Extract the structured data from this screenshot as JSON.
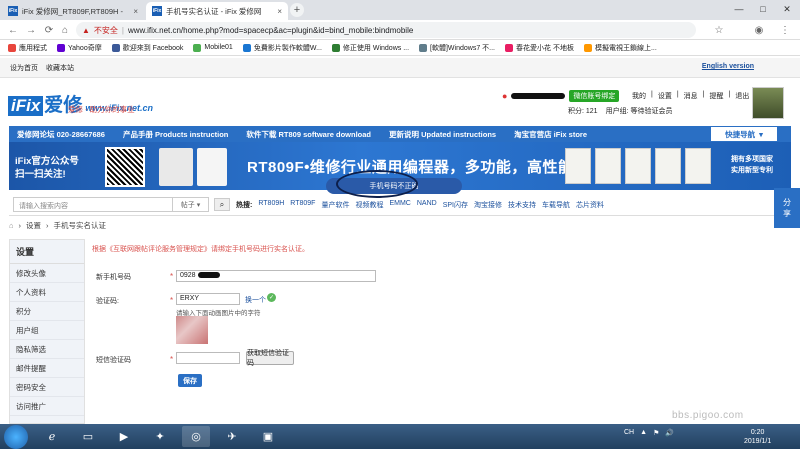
{
  "browser": {
    "tabs": [
      {
        "title": "iFix 爱修网_RT809F,RT809H -",
        "active": false
      },
      {
        "title": "手机号实名认证 - iFix 爱修网",
        "active": true
      }
    ],
    "new_tab_glyph": "+",
    "omnibox": {
      "security_label": "不安全",
      "url": "www.ifix.net.cn/home.php?mod=spacecp&ac=plugin&id=bind_mobile:bindmobile"
    },
    "bookmarks": [
      "應用程式",
      "Yahoo奇摩",
      "歡迎來到 Facebook",
      "Mobile01",
      "免費影片製作軟體W...",
      "修正使用 Windows ...",
      "[軟體]Windows7 不...",
      "春花愛小花 不地板",
      "模擬電視王鎖線上..."
    ],
    "window_controls": [
      "—",
      "□",
      "✕"
    ]
  },
  "site": {
    "topbar": {
      "left_links": [
        "设为首页",
        "收藏本站"
      ],
      "right_link": "English version"
    },
    "logo": {
      "mark": "iFix",
      "name": "爱修",
      "domain": "www.iFix.net.cn",
      "slogan": "爱修 - 助力你的事业"
    },
    "user": {
      "wechat_button": "微信账号绑定",
      "links": [
        "我的",
        "设置",
        "消息",
        "提醒",
        "退出"
      ],
      "points": "积分: 121",
      "group": "用户组: 等待验证会员"
    },
    "nav": {
      "items": [
        "爱修网论坛 020-28667686",
        "产品手册 Products instruction",
        "软件下载 RT809 software download",
        "更新说明 Updated instructions",
        "淘宝官营店 iFix store"
      ],
      "quick_nav": "快捷导航"
    },
    "banner": {
      "wechat_line1": "iFix官方公众号",
      "wechat_line2": "扫一扫关注!",
      "headline": "RT809F•维修行业通用编程器，多功能，高性能",
      "right_line1": "拥有多项国家",
      "right_line2": "实用新型专利"
    },
    "toast": "手机号码不正确",
    "search": {
      "placeholder": "请输入搜索内容",
      "type": "帖子",
      "hot_label": "热搜:",
      "hot_items": [
        "RT809H",
        "RT809F",
        "量产软件",
        "视频教程",
        "EMMC",
        "NAND",
        "SPI闪存",
        "淘宝接修",
        "技术支持",
        "车载导航",
        "芯片资料"
      ]
    },
    "breadcrumb": [
      "设置",
      "手机号实名认证"
    ],
    "share": [
      "分",
      "享"
    ]
  },
  "sidebar": {
    "title": "设置",
    "items": [
      "修改头像",
      "个人资料",
      "积分",
      "用户组",
      "隐私筛选",
      "邮件提醒",
      "密码安全",
      "访问推广"
    ]
  },
  "form": {
    "notice": "根据《互联网跟帖评论服务管理规定》请绑定手机号码进行实名认证。",
    "phone_label": "新手机号码",
    "phone_value": "0928",
    "captcha_label": "验证码:",
    "captcha_value": "ERXY",
    "captcha_refresh": "换一个",
    "captcha_hint": "请输入下面动画图片中的字符",
    "sms_label": "短信验证码",
    "sms_button": "获取短信验证码",
    "save_button": "保存"
  },
  "watermark": "bbs.pigoo.com",
  "taskbar": {
    "tray": [
      "CH",
      "▲",
      "⚑",
      "🔊"
    ],
    "time": "0:20",
    "date": "2019/1/1"
  }
}
